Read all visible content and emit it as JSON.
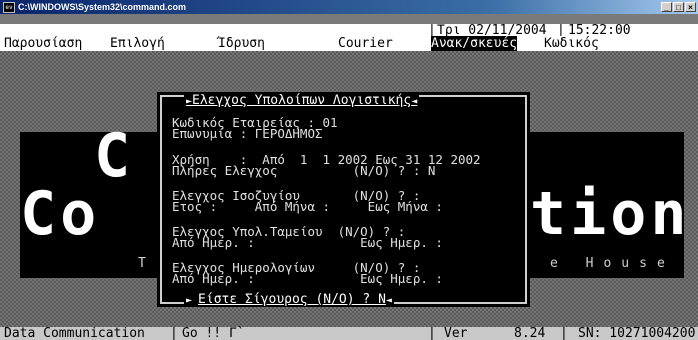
{
  "window": {
    "title": "C:\\WINDOWS\\System32\\command.com",
    "minimize": "_",
    "maximize": "□",
    "close": "×"
  },
  "status_top": {
    "date": "Τρι 02/11/2004",
    "time": "15:22:00"
  },
  "menu": [
    {
      "label": "Παρουσίαση",
      "active": false
    },
    {
      "label": "Επιλογή",
      "active": false
    },
    {
      "label": "Ίδρυση",
      "active": false
    },
    {
      "label": "Courier",
      "active": false
    },
    {
      "label": "Ανακ/σκευές",
      "active": true
    },
    {
      "label": "Κωδικός",
      "active": false
    }
  ],
  "banner": {
    "left_text": "Co",
    "top_letter": "C",
    "right_text": "tion",
    "left_small": "T",
    "right_small": "e House"
  },
  "dialog": {
    "title": "Ελεγχος Υπολοίπων Λογιστικής",
    "lines": [
      "Κωδικός Εταιρείας : 01",
      "Επωνυμία : ΓΕΡΟΔΗΜΟΣ",
      "",
      "Χρήση    :  Από  1  1 2002 Εως 31 12 2002",
      "Πλήρες Ελεγχος          (Ν/Ο) ? : Ν",
      "",
      "Ελεγχος Ισοζυγίου       (Ν/Ο) ? :",
      "Ετος :     Από Μήνα :     Εως Μήνα :",
      "",
      "Ελεγχος Υπολ.Ταμείου  (Ν/Ο) ? :",
      "Από Ημερ. :              Εως Ημερ. :",
      "",
      "Ελεγχος Ημερολογίων     (Ν/Ο) ? :",
      "Από Ημερ. :              Εως Ημερ. :"
    ],
    "prompt": "Είστε Σίγουρος (Ν/Ο) ? ",
    "answer": "Ν"
  },
  "status_bottom": {
    "left": "Data Communication",
    "go": "Go !! Γ`",
    "version_label": "Ver",
    "version": "8.24",
    "serial": "SN: 10271004200"
  }
}
